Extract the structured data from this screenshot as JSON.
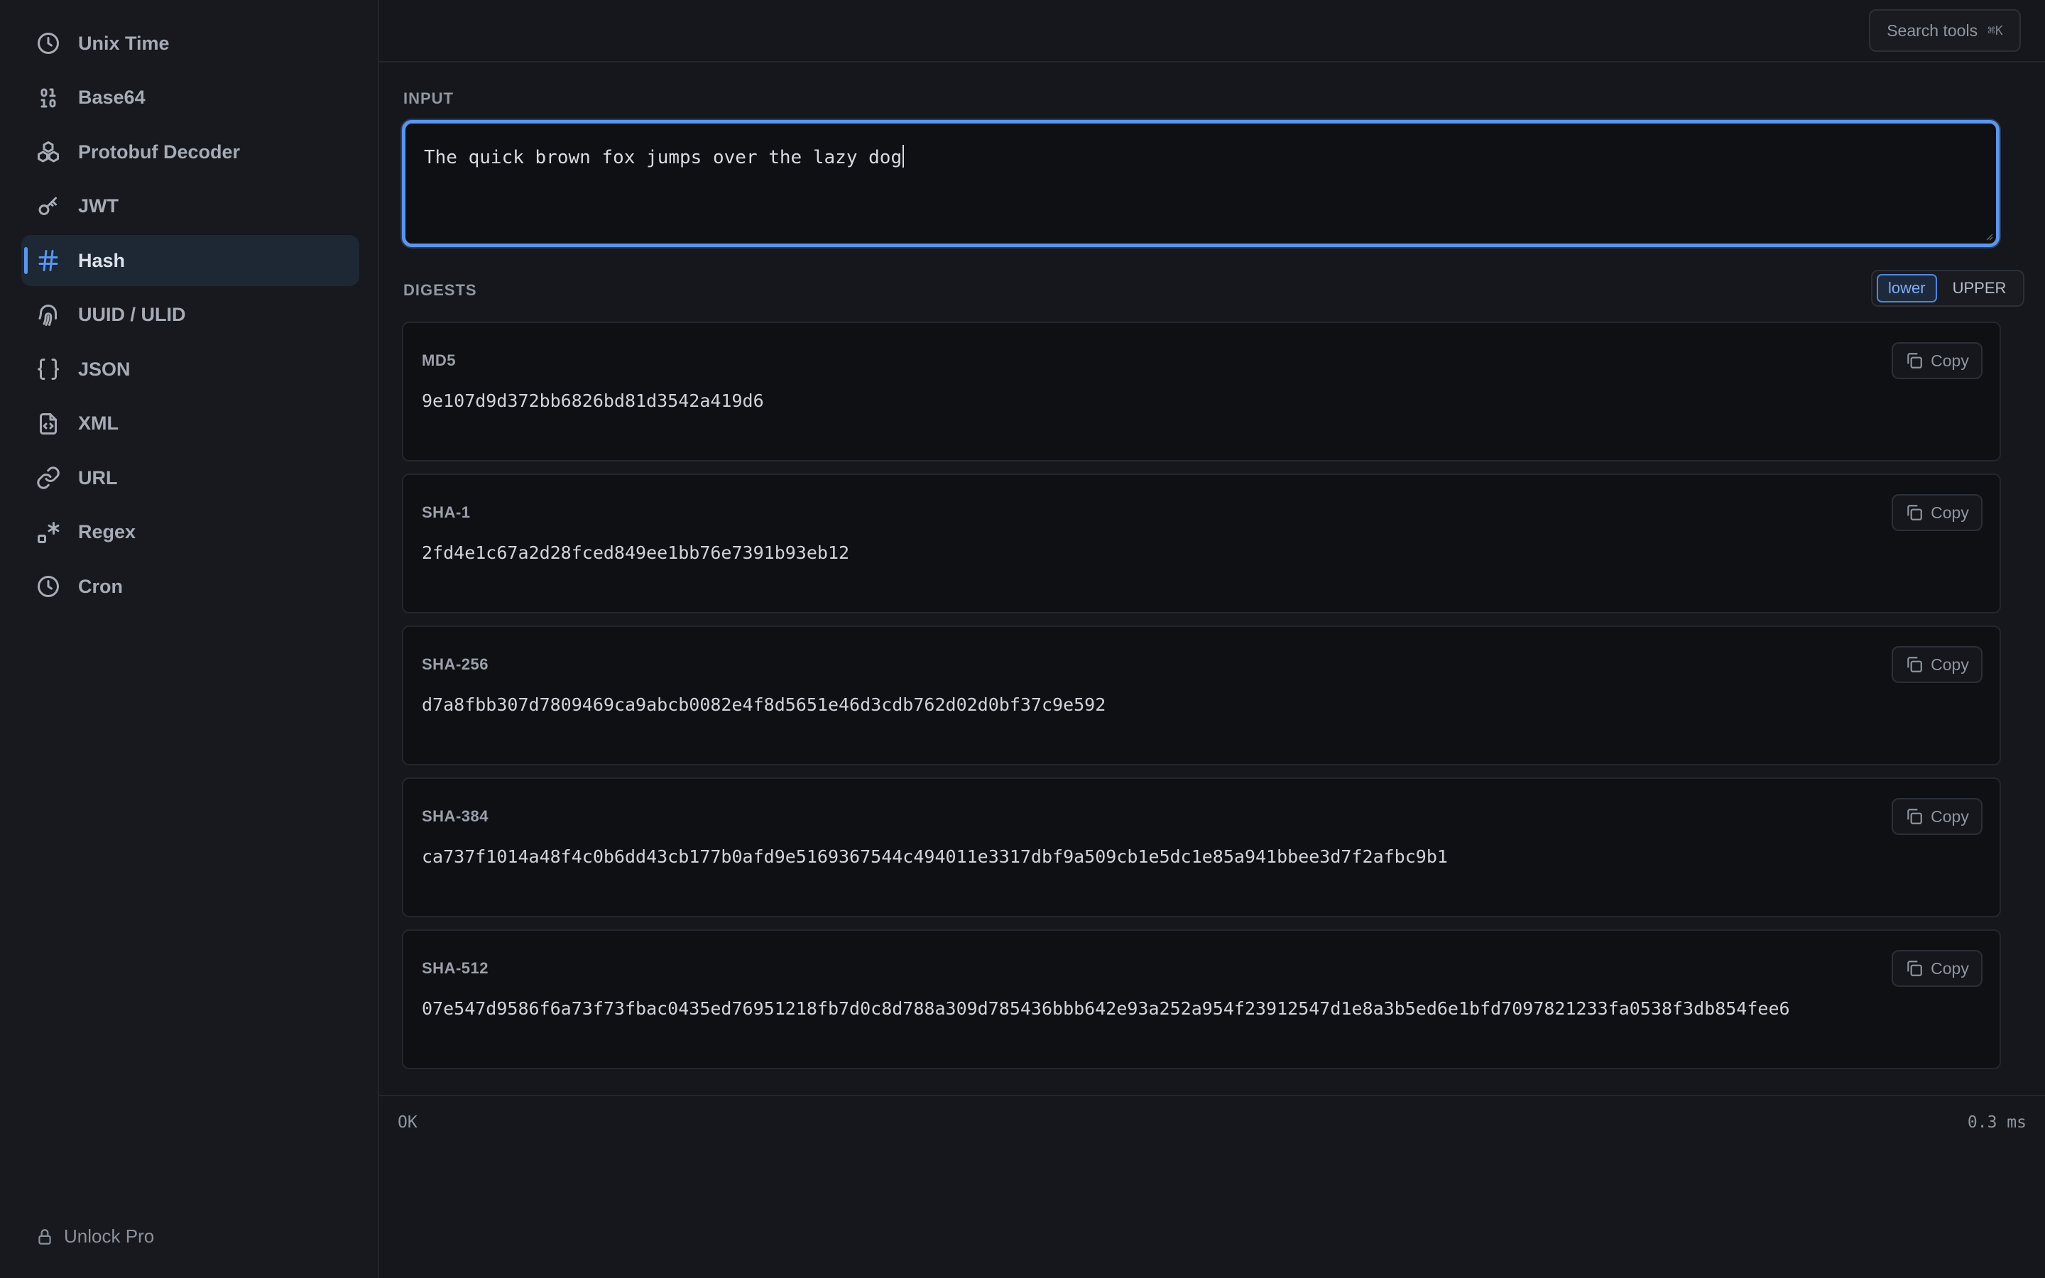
{
  "sidebar": {
    "items": [
      {
        "label": "Unix Time",
        "icon": "clock-icon"
      },
      {
        "label": "Base64",
        "icon": "binary-icon"
      },
      {
        "label": "Protobuf Decoder",
        "icon": "boxes-icon"
      },
      {
        "label": "JWT",
        "icon": "key-icon"
      },
      {
        "label": "Hash",
        "icon": "hash-icon",
        "active": true
      },
      {
        "label": "UUID / ULID",
        "icon": "fingerprint-icon"
      },
      {
        "label": "JSON",
        "icon": "braces-icon"
      },
      {
        "label": "XML",
        "icon": "file-code-icon"
      },
      {
        "label": "URL",
        "icon": "link-icon"
      },
      {
        "label": "Regex",
        "icon": "regex-icon"
      },
      {
        "label": "Cron",
        "icon": "clock-icon"
      }
    ],
    "unlock_label": "Unlock Pro"
  },
  "topbar": {
    "search_label": "Search tools",
    "search_shortcut": "⌘K"
  },
  "input": {
    "label": "INPUT",
    "value": "The quick brown fox jumps over the lazy dog"
  },
  "digests": {
    "label": "DIGESTS",
    "case_options": [
      "lower",
      "UPPER"
    ],
    "selected_case": "lower",
    "copy_label": "Copy",
    "items": [
      {
        "name": "MD5",
        "value": "9e107d9d372bb6826bd81d3542a419d6"
      },
      {
        "name": "SHA-1",
        "value": "2fd4e1c67a2d28fced849ee1bb76e7391b93eb12"
      },
      {
        "name": "SHA-256",
        "value": "d7a8fbb307d7809469ca9abcb0082e4f8d5651e46d3cdb762d02d0bf37c9e592"
      },
      {
        "name": "SHA-384",
        "value": "ca737f1014a48f4c0b6dd43cb177b0afd9e5169367544c494011e3317dbf9a509cb1e5dc1e85a941bbee3d7f2afbc9b1"
      },
      {
        "name": "SHA-512",
        "value": "07e547d9586f6a73f73fbac0435ed76951218fb7d0c8d788a309d785436bbb642e93a252a954f23912547d1e8a3b5ed6e1bfd7097821233fa0538f3db854fee6"
      }
    ]
  },
  "status": {
    "state": "OK",
    "timing": "0.3 ms"
  },
  "colors": {
    "accent": "#5b96ee",
    "background": "#15171c",
    "panel": "#0f1014"
  }
}
